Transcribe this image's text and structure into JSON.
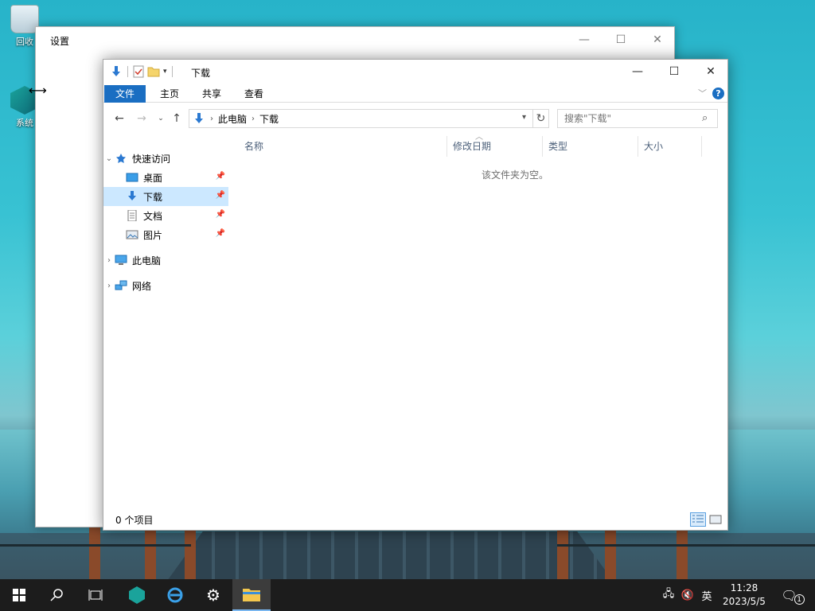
{
  "desktop": {
    "icons": [
      {
        "label": "回收",
        "icon": "recycle-bin-icon"
      },
      {
        "label": "系统",
        "icon": "system-app-icon"
      }
    ]
  },
  "settings_window": {
    "title": "设置",
    "controls": {
      "minimize": "—",
      "maximize": "☐",
      "close": "✕"
    }
  },
  "explorer": {
    "title": "下载",
    "controls": {
      "minimize": "—",
      "maximize": "☐",
      "close": "✕"
    },
    "ribbon_tabs": [
      "文件",
      "主页",
      "共享",
      "查看"
    ],
    "help": "?",
    "address": {
      "crumbs": [
        "此电脑",
        "下载"
      ]
    },
    "search": {
      "placeholder": "搜索\"下载\""
    },
    "nav": {
      "quick_access": {
        "label": "快速访问",
        "items": [
          {
            "label": "桌面",
            "icon": "desktop-folder-icon"
          },
          {
            "label": "下载",
            "icon": "download-folder-icon"
          },
          {
            "label": "文档",
            "icon": "documents-folder-icon"
          },
          {
            "label": "图片",
            "icon": "pictures-folder-icon"
          }
        ]
      },
      "this_pc": "此电脑",
      "network": "网络"
    },
    "columns": [
      "名称",
      "修改日期",
      "类型",
      "大小"
    ],
    "empty_message": "该文件夹为空。",
    "status": "0 个项目"
  },
  "taskbar": {
    "ime": "英",
    "time": "11:28",
    "date": "2023/5/5",
    "notification_count": "1"
  },
  "colors": {
    "accent": "#1a6ec2",
    "selected": "#cce8ff",
    "taskbar": "#1c1c1c"
  }
}
